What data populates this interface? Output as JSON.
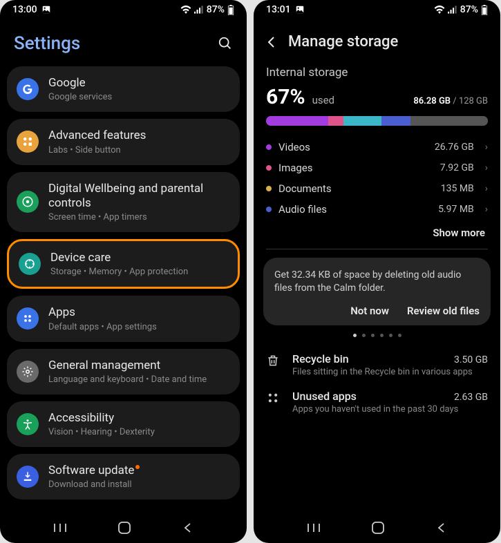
{
  "left": {
    "status": {
      "time": "13:00",
      "battery_pct": "87%"
    },
    "header_title": "Settings",
    "items": [
      {
        "title": "Google",
        "sub": "Google services",
        "icon_bg": "#3a72e8",
        "icon": "google"
      },
      {
        "title": "Advanced features",
        "sub": "Labs  •  Side button",
        "icon_bg": "#e8a33c",
        "icon": "advanced"
      },
      {
        "title": "Digital Wellbeing and parental controls",
        "sub": "Screen time  •  App timers",
        "icon_bg": "#1aa05a",
        "icon": "wellbeing"
      },
      {
        "title": "Device care",
        "sub": "Storage  •  Memory  •  App protection",
        "icon_bg": "#1aa090",
        "icon": "devicecare",
        "highlighted": true
      },
      {
        "title": "Apps",
        "sub": "Default apps  •  App settings",
        "icon_bg": "#3a72e8",
        "icon": "apps"
      },
      {
        "title": "General management",
        "sub": "Language and keyboard  •  Date and time",
        "icon_bg": "#6a6a6a",
        "icon": "general"
      },
      {
        "title": "Accessibility",
        "sub": "Vision  •  Hearing  •  Dexterity",
        "icon_bg": "#1aa05a",
        "icon": "accessibility"
      },
      {
        "title": "Software update",
        "sub": "Download and install",
        "icon_bg": "#3a5fe0",
        "icon": "update",
        "badge": true
      }
    ]
  },
  "right": {
    "status": {
      "time": "13:01",
      "battery_pct": "87%"
    },
    "header_title": "Manage storage",
    "section_title": "Internal storage",
    "percent": "67%",
    "percent_label": "used",
    "used_gb": "86.28 GB",
    "total_gb": "128 GB",
    "bar": [
      {
        "color": "#a23be0",
        "pct": 28
      },
      {
        "color": "#e0548c",
        "pct": 7
      },
      {
        "color": "#3cb7c7",
        "pct": 17
      },
      {
        "color": "#4a5ed0",
        "pct": 13
      },
      {
        "color": "#555555",
        "pct": 35
      }
    ],
    "categories": [
      {
        "label": "Videos",
        "size": "26.76 GB",
        "color": "#a23be0"
      },
      {
        "label": "Images",
        "size": "7.92 GB",
        "color": "#e0548c"
      },
      {
        "label": "Documents",
        "size": "135 MB",
        "color": "#d8b04a"
      },
      {
        "label": "Audio files",
        "size": "5.97 MB",
        "color": "#4a5ed0"
      }
    ],
    "show_more": "Show more",
    "tip": {
      "text": "Get 32.34 KB of space by deleting old audio files from the Calm folder.",
      "not_now": "Not now",
      "review": "Review old files"
    },
    "mgmt": [
      {
        "title": "Recycle bin",
        "sub": "Files sitting in the Recycle bin in various apps",
        "size": "3.50 GB",
        "icon": "trash"
      },
      {
        "title": "Unused apps",
        "sub": "Apps you haven't used in the past 30 days",
        "size": "2.63 GB",
        "icon": "grid"
      }
    ]
  }
}
